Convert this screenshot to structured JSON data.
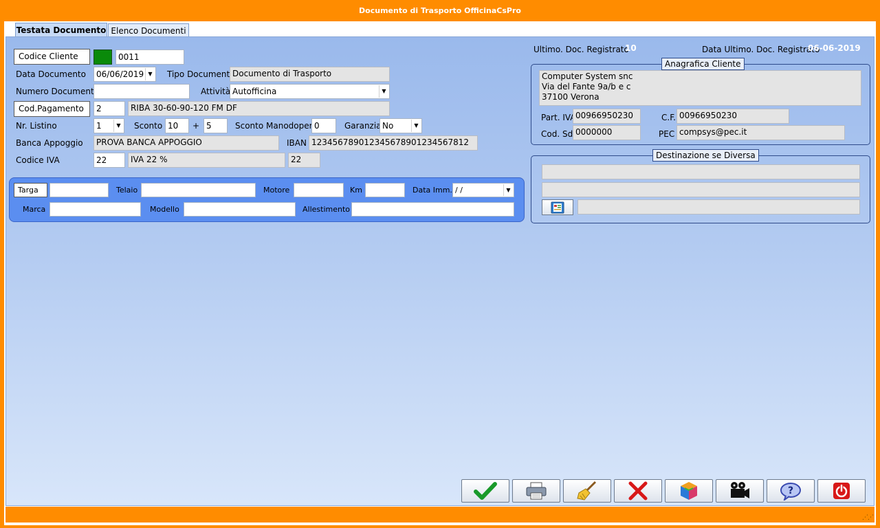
{
  "window": {
    "title": "Documento di Trasporto OfficinaCsPro"
  },
  "tabs": [
    {
      "label": "Testata Documento",
      "active": true
    },
    {
      "label": "Elenco Documenti",
      "active": false
    }
  ],
  "header_form": {
    "codice_cliente_label": "Codice Cliente",
    "codice_cliente_value": "0011",
    "data_documento_label": "Data Documento",
    "data_documento_value": "06/06/2019",
    "tipo_documento_label": "Tipo Documento",
    "tipo_documento_value": "Documento di Trasporto",
    "numero_documento_label": "Numero Documento",
    "numero_documento_value": "",
    "attivita_label": "Attività",
    "attivita_value": "Autofficina",
    "cod_pagamento_label": "Cod.Pagamento",
    "cod_pagamento_value": "2",
    "cod_pagamento_desc": "RIBA 30-60-90-120 FM DF",
    "nr_listino_label": "Nr. Listino",
    "nr_listino_value": "1",
    "sconto_label": "Sconto",
    "sconto_value1": "10",
    "sconto_plus": "+",
    "sconto_value2": "5",
    "sconto_manodopera_label": "Sconto Manodopera",
    "sconto_manodopera_value": "0",
    "garanzia_label": "Garanzia",
    "garanzia_value": "No",
    "banca_label": "Banca Appoggio",
    "banca_value": "PROVA BANCA APPOGGIO",
    "iban_label": "IBAN",
    "iban_value": "123456789012345678901234567812",
    "codice_iva_label": "Codice IVA",
    "codice_iva_value": "22",
    "codice_iva_desc": "IVA 22 %",
    "codice_iva_perc": "22"
  },
  "vehicle": {
    "targa_label": "Targa",
    "telaio_label": "Telaio",
    "motore_label": "Motore",
    "km_label": "Km",
    "data_imm_label": "Data Imm.",
    "data_imm_value": " /  /",
    "marca_label": "Marca",
    "modello_label": "Modello",
    "allestimento_label": "Allestimento"
  },
  "stats": {
    "ultimo_label": "Ultimo. Doc. Registrato",
    "ultimo_value": "10",
    "data_ultimo_label": "Data Ultimo. Doc. Registrato",
    "data_ultimo_value": "06-06-2019"
  },
  "anagrafica": {
    "legend": "Anagrafica Cliente",
    "line1": "Computer System snc",
    "line2": "Via del Fante 9a/b e c",
    "line3": "37100 Verona",
    "piva_label": "Part. IVA",
    "piva_value": "00966950230",
    "cf_label": "C.F.",
    "cf_value": "00966950230",
    "sdi_label": "Cod. SdI",
    "sdi_value": "0000000",
    "pec_label": "PEC",
    "pec_value": "compsys@pec.it"
  },
  "destinazione": {
    "legend": "Destinazione se Diversa"
  },
  "toolbar_icons": [
    "check-icon",
    "printer-icon",
    "broom-icon",
    "cancel-x-icon",
    "cube-icon",
    "camera-icon",
    "help-icon",
    "power-icon"
  ],
  "colors": {
    "accent_orange": "#ff8c00",
    "green_status": "#0a8a0a",
    "vehicle_panel": "#5b8ef0"
  }
}
